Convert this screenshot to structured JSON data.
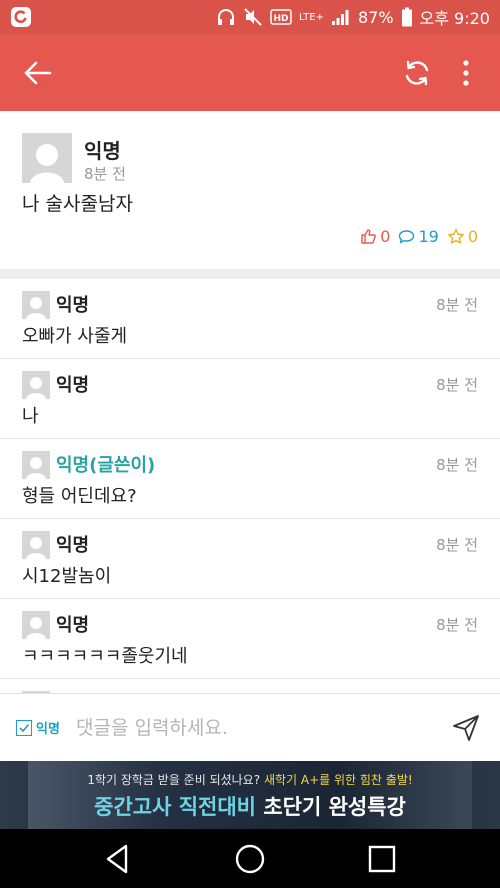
{
  "status_bar": {
    "battery": "87%",
    "time": "오후 9:20",
    "network": "LTE+",
    "icons": [
      "carrier-logo-icon",
      "headphones-icon",
      "mute-icon",
      "hd-icon",
      "lte-icon",
      "signal-icon",
      "battery-icon"
    ]
  },
  "app_bar": {
    "accent_color": "#e5584f",
    "icons": [
      "back-arrow-icon",
      "refresh-icon",
      "more-vert-icon"
    ]
  },
  "post": {
    "author": "익명",
    "time": "8분 전",
    "body": "나 술사줄남자",
    "likes": "0",
    "comments": "19",
    "stars": "0"
  },
  "comments": [
    {
      "author": "익명",
      "time": "8분 전",
      "body": "오빠가 사줄게",
      "is_op": false
    },
    {
      "author": "익명",
      "time": "8분 전",
      "body": "나",
      "is_op": false
    },
    {
      "author": "익명(글쓴이)",
      "time": "8분 전",
      "body": "형들 어딘데요?",
      "is_op": true
    },
    {
      "author": "익명",
      "time": "8분 전",
      "body": "시12발놈이",
      "is_op": false
    },
    {
      "author": "익명",
      "time": "8분 전",
      "body": "ㅋㅋㅋㅋㅋㅋ졸웃기네",
      "is_op": false
    }
  ],
  "input_bar": {
    "anonymous_label": "익명",
    "anonymous_checked": true,
    "placeholder": "댓글을 입력하세요."
  },
  "ad": {
    "line1_prefix": "1학기 장학금 받을 준비 되셨나요?",
    "line1_highlight": "새학기 A+를 위한 힘찬 출발!",
    "line2_part1": "중간고사 직전대비",
    "line2_part2": "초단기 완성특강"
  }
}
